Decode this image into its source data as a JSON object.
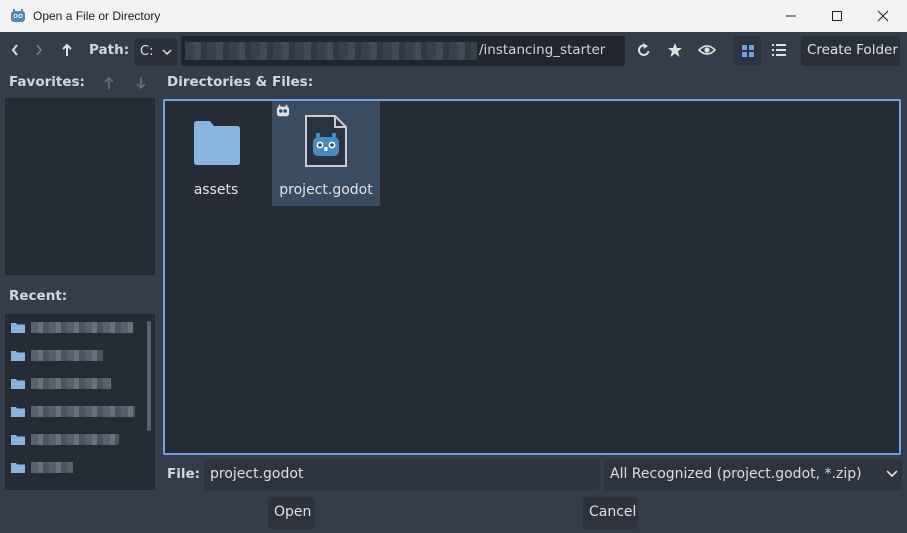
{
  "window": {
    "title": "Open a File or Directory"
  },
  "toolbar": {
    "path_label": "Path:",
    "drive": "C:",
    "path_suffix": "/instancing_starter",
    "create_folder_label": "Create Folder"
  },
  "favorites": {
    "label": "Favorites:"
  },
  "recent": {
    "label": "Recent:"
  },
  "files": {
    "label": "Directories & Files:",
    "items": [
      {
        "name": "assets",
        "type": "folder"
      },
      {
        "name": "project.godot",
        "type": "godot-project"
      }
    ]
  },
  "footer": {
    "file_label": "File:",
    "file_value": "project.godot",
    "filter_value": "All Recognized (project.godot, *.zip)",
    "open_label": "Open",
    "cancel_label": "Cancel"
  },
  "colors": {
    "accent": "#6ea3e0",
    "background": "#363d4a",
    "panel": "#262c36",
    "folder": "#8ab4e0",
    "selected": "#3a4c60"
  },
  "icons": {
    "app": "godot-icon",
    "back": "chevron-left-icon",
    "forward": "chevron-right-icon",
    "up": "arrow-up-icon",
    "refresh": "refresh-icon",
    "favorite": "star-icon",
    "hidden": "eye-icon",
    "grid_view": "grid-view-icon",
    "list_view": "list-view-icon"
  }
}
